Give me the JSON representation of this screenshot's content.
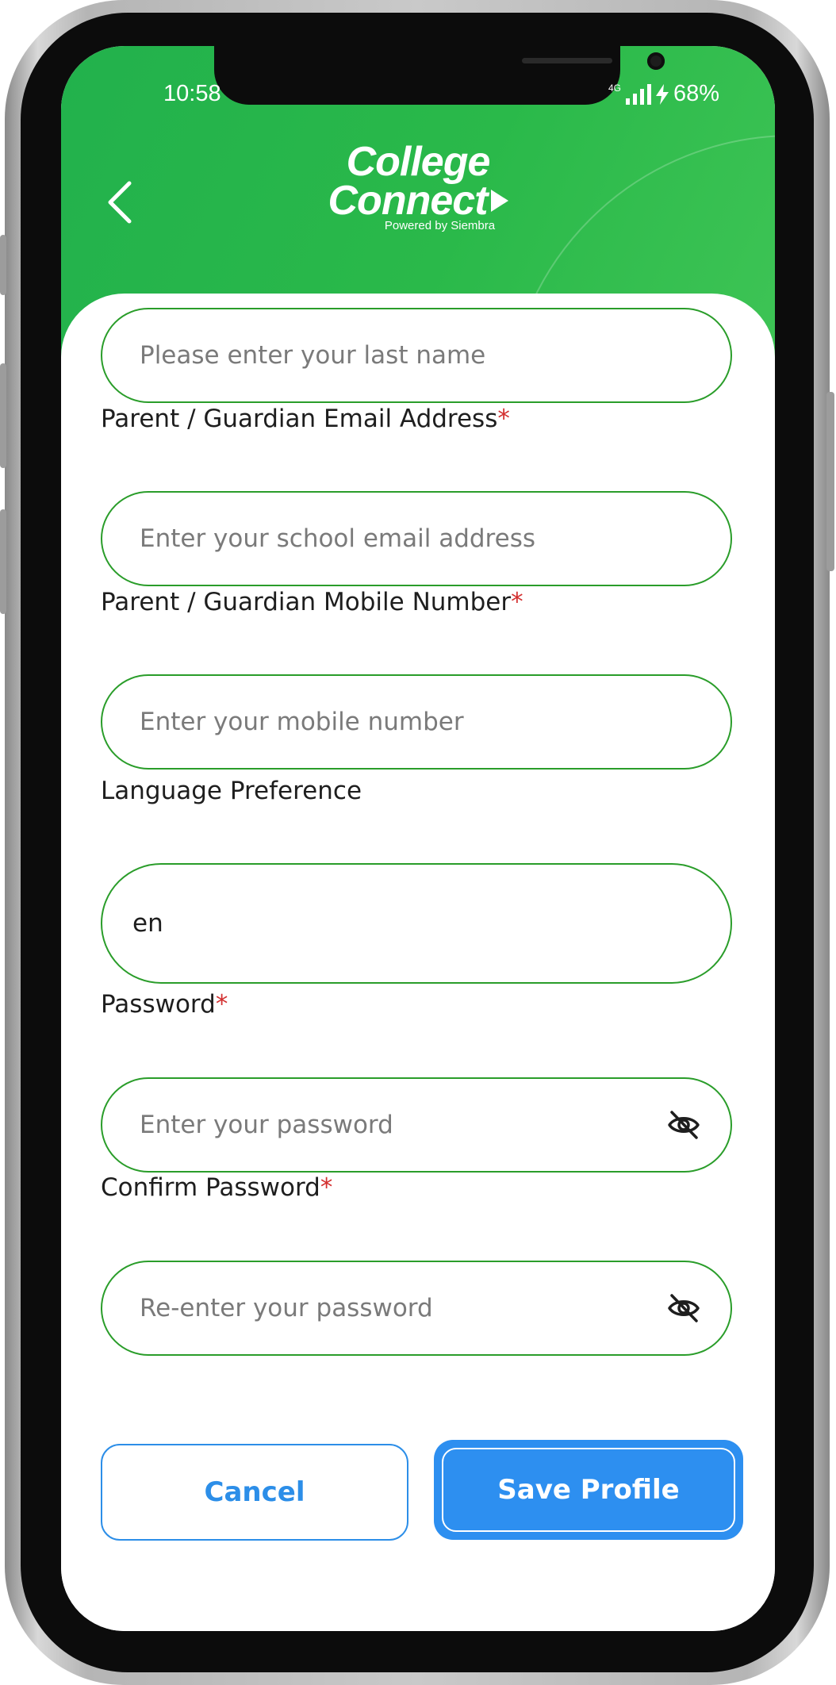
{
  "status_bar": {
    "time": "10:58",
    "network": "4G",
    "battery": "68%"
  },
  "header": {
    "logo_line1": "College",
    "logo_line2": "Connect",
    "logo_tagline": "Powered by Siembra"
  },
  "form": {
    "last_name": {
      "placeholder": "Please enter your last name"
    },
    "parent_email": {
      "label": "Parent / Guardian Email Address",
      "required_mark": "*",
      "placeholder": "Enter your school email address"
    },
    "parent_mobile": {
      "label": "Parent / Guardian Mobile Number",
      "required_mark": "*",
      "placeholder": "Enter your mobile number"
    },
    "language": {
      "label": "Language Preference",
      "value": "en"
    },
    "password": {
      "label": "Password",
      "required_mark": "*",
      "placeholder": "Enter your password"
    },
    "confirm_password": {
      "label": "Confirm Password",
      "required_mark": "*",
      "placeholder": "Re-enter your password"
    }
  },
  "actions": {
    "cancel_label": "Cancel",
    "save_label": "Save Profile"
  },
  "colors": {
    "header_green": "#2ab94a",
    "field_border": "#2a9d2a",
    "primary_blue": "#2d8ff0",
    "required_red": "#d32f2f"
  },
  "icons": {
    "back": "chevron-left-icon",
    "password_toggle": "eye-off-icon"
  }
}
